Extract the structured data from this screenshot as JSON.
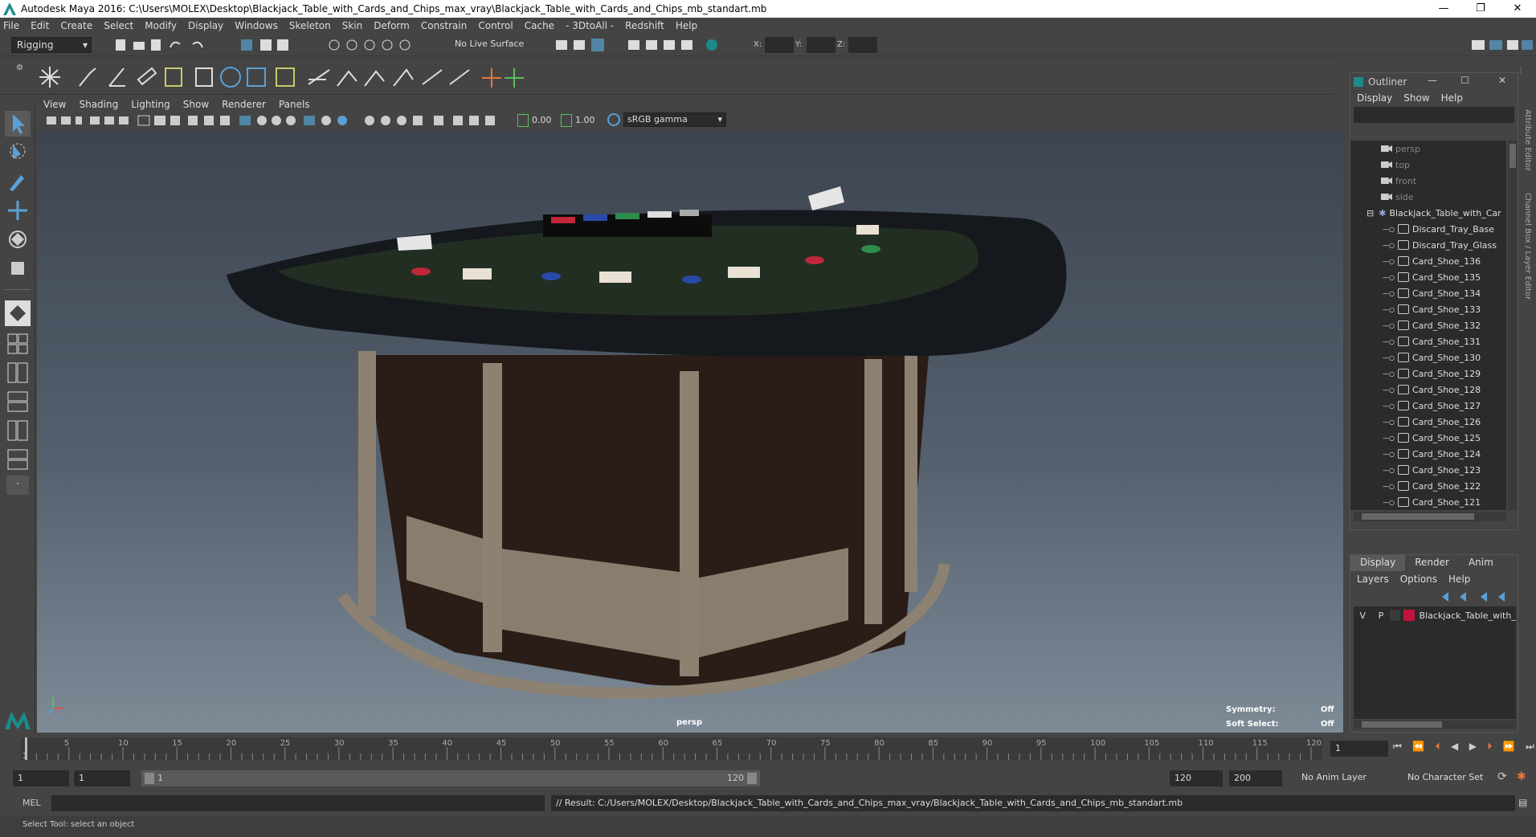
{
  "window": {
    "title": "Autodesk Maya 2016: C:\\Users\\MOLEX\\Desktop\\Blackjack_Table_with_Cards_and_Chips_max_vray\\Blackjack_Table_with_Cards_and_Chips_mb_standart.mb",
    "minimize": "—",
    "restore": "❐",
    "close": "✕"
  },
  "menubar": [
    "File",
    "Edit",
    "Create",
    "Select",
    "Modify",
    "Display",
    "Windows",
    "Skeleton",
    "Skin",
    "Deform",
    "Constrain",
    "Control",
    "Cache",
    "- 3DtoAll -",
    "Redshift",
    "Help"
  ],
  "statusline": {
    "mode": "Rigging",
    "live_surface": "No Live Surface",
    "x_label": "X:",
    "y_label": "Y:",
    "z_label": "Z:"
  },
  "viewport": {
    "menus": [
      "View",
      "Shading",
      "Lighting",
      "Show",
      "Renderer",
      "Panels"
    ],
    "exposure": "0.00",
    "gamma": "1.00",
    "colorspace": "sRGB gamma",
    "camera": "persp",
    "hud": {
      "symmetry_label": "Symmetry:",
      "symmetry_value": "Off",
      "soft_select_label": "Soft Select:",
      "soft_select_value": "Off"
    }
  },
  "outliner": {
    "title": "Outliner",
    "menus": [
      "Display",
      "Show",
      "Help"
    ],
    "items": [
      {
        "label": "persp",
        "kind": "camera"
      },
      {
        "label": "top",
        "kind": "camera"
      },
      {
        "label": "front",
        "kind": "camera"
      },
      {
        "label": "side",
        "kind": "camera"
      },
      {
        "label": "Blackjack_Table_with_Car",
        "kind": "group"
      },
      {
        "label": "Discard_Tray_Base",
        "kind": "mesh"
      },
      {
        "label": "Discard_Tray_Glass",
        "kind": "mesh"
      },
      {
        "label": "Card_Shoe_136",
        "kind": "mesh"
      },
      {
        "label": "Card_Shoe_135",
        "kind": "mesh"
      },
      {
        "label": "Card_Shoe_134",
        "kind": "mesh"
      },
      {
        "label": "Card_Shoe_133",
        "kind": "mesh"
      },
      {
        "label": "Card_Shoe_132",
        "kind": "mesh"
      },
      {
        "label": "Card_Shoe_131",
        "kind": "mesh"
      },
      {
        "label": "Card_Shoe_130",
        "kind": "mesh"
      },
      {
        "label": "Card_Shoe_129",
        "kind": "mesh"
      },
      {
        "label": "Card_Shoe_128",
        "kind": "mesh"
      },
      {
        "label": "Card_Shoe_127",
        "kind": "mesh"
      },
      {
        "label": "Card_Shoe_126",
        "kind": "mesh"
      },
      {
        "label": "Card_Shoe_125",
        "kind": "mesh"
      },
      {
        "label": "Card_Shoe_124",
        "kind": "mesh"
      },
      {
        "label": "Card_Shoe_123",
        "kind": "mesh"
      },
      {
        "label": "Card_Shoe_122",
        "kind": "mesh"
      },
      {
        "label": "Card_Shoe_121",
        "kind": "mesh"
      }
    ]
  },
  "layer_editor": {
    "tabs": [
      "Display",
      "Render",
      "Anim"
    ],
    "menus": [
      "Layers",
      "Options",
      "Help"
    ],
    "layer": {
      "v": "V",
      "p": "P",
      "name": "Blackjack_Table_with_C",
      "color": "#c0143c"
    }
  },
  "side_tabs": [
    "Attribute Editor",
    "Channel Box / Layer Editor"
  ],
  "timeline": {
    "ticks": [
      "5",
      "10",
      "15",
      "20",
      "25",
      "30",
      "35",
      "40",
      "45",
      "50",
      "55",
      "60",
      "65",
      "70",
      "75",
      "80",
      "85",
      "90",
      "95",
      "100",
      "105",
      "110",
      "115",
      "120"
    ],
    "start_tick": "1",
    "current_frame": "1"
  },
  "range": {
    "start": "1",
    "playback_start": "1",
    "range_start": "1",
    "range_end": "120",
    "playback_end": "120",
    "end": "200",
    "anim_layer": "No Anim Layer",
    "character_set": "No Character Set"
  },
  "command": {
    "lang": "MEL",
    "result": "// Result: C:/Users/MOLEX/Desktop/Blackjack_Table_with_Cards_and_Chips_max_vray/Blackjack_Table_with_Cards_and_Chips_mb_standart.mb"
  },
  "help_line": "Select Tool: select an object",
  "colors": {
    "accent": "#5285a6",
    "panel": "#444444",
    "field": "#2b2b2b",
    "layer_color": "#c0143c"
  }
}
